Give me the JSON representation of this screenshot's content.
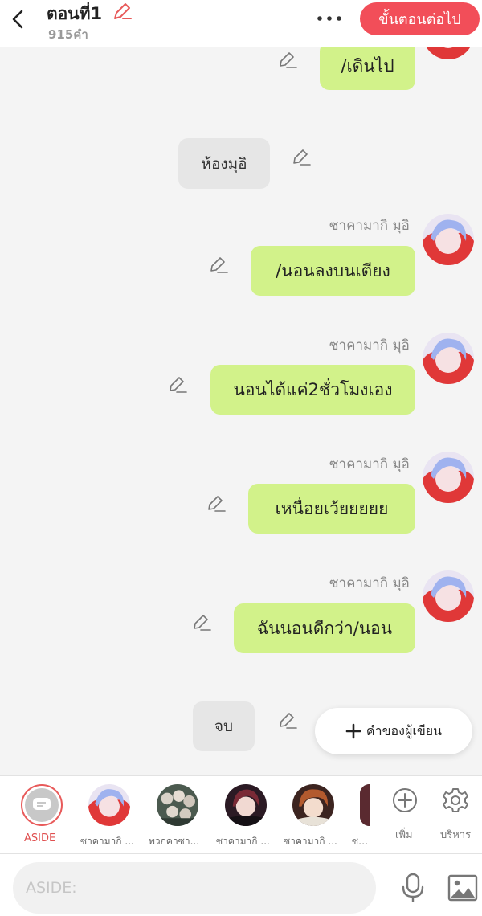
{
  "header": {
    "title": "ตอนที่1",
    "word_count": "915คำ",
    "next_button": "ขั้นตอนต่อไป"
  },
  "messages": [
    {
      "type": "bubble",
      "text": "/เดินไป"
    },
    {
      "type": "narration",
      "text": "ห้องมุอิ"
    },
    {
      "type": "bubble",
      "sender": "ซาคามากิ มุอิ",
      "text": "/นอนลงบนเตียง"
    },
    {
      "type": "bubble",
      "sender": "ซาคามากิ มุอิ",
      "text": "นอนได้แค่2ชั่วโมงเอง"
    },
    {
      "type": "bubble",
      "sender": "ซาคามากิ มุอิ",
      "text": "เหนื่อยเว้ยยยยย"
    },
    {
      "type": "bubble",
      "sender": "ซาคามากิ มุอิ",
      "text": "ฉันนอนดีกว่า/นอน"
    },
    {
      "type": "narration",
      "text": "จบ"
    }
  ],
  "author_note_button": "คำของผู้เขียน",
  "charbar": {
    "aside_label": "ASIDE",
    "characters": [
      "ซาคามากิ ...",
      "พวกคาซา...",
      "ซาคามากิ ...",
      "ซาคามากิ ...",
      "ซาค"
    ],
    "add_label": "เพิ่ม",
    "manage_label": "บริหาร"
  },
  "input": {
    "placeholder": "ASIDE:"
  },
  "colors": {
    "accent": "#f24e59",
    "bubble": "#d2f28a",
    "narration": "#e6e6e6"
  }
}
